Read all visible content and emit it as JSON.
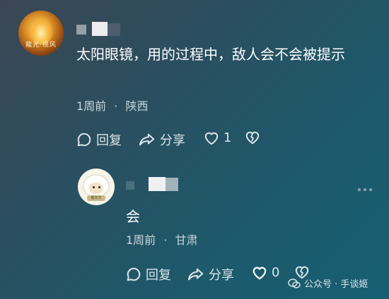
{
  "comment": {
    "text": "太阳眼镜，用的过程中，敌人会不会被提示",
    "time": "1周前",
    "separator": "·",
    "location": "陕西",
    "avatar_text": "龍光·视风",
    "actions": {
      "reply_label": "回复",
      "share_label": "分享",
      "like_count": "1"
    }
  },
  "reply": {
    "text": "会",
    "time": "1周前",
    "separator": "·",
    "location": "甘肃",
    "avatar_badge": "暖羊羊",
    "actions": {
      "reply_label": "回复",
      "share_label": "分享",
      "like_count": "0"
    }
  },
  "watermark": {
    "text": "公众号 · 手谈姬"
  },
  "colors": {
    "text_primary": "#ffffff",
    "text_secondary": "#c9d6da",
    "icon": "#dde6e8"
  },
  "icons": [
    "comment-bubble-icon",
    "share-arrow-icon",
    "heart-icon",
    "broken-heart-icon",
    "more-dots-icon",
    "wechat-logo-icon"
  ]
}
